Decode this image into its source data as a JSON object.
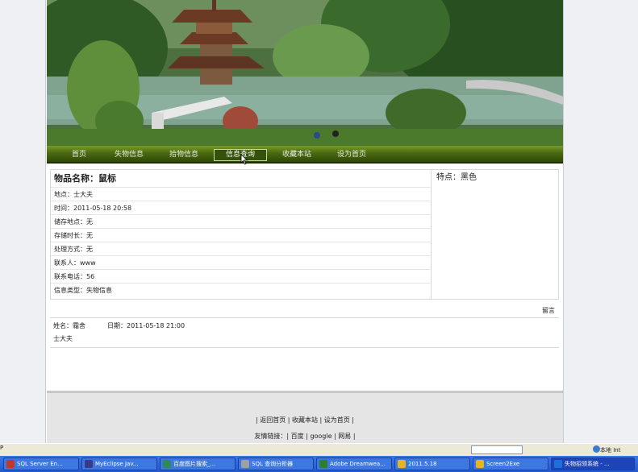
{
  "nav": {
    "items": [
      "首页",
      "失物信息",
      "拾物信息",
      "信息查询",
      "收藏本站",
      "设为首页"
    ],
    "active_index": 3
  },
  "item": {
    "name_label": "物品名称：",
    "name_value": "鼠标",
    "location": "地点：士大夫",
    "time": "时间：2011-05-18 20:58",
    "storage_location": "储存地点：无",
    "storage_duration": "存储时长：无",
    "handling_method": "处理方式：无",
    "contact_person": "联系人：www",
    "contact_phone": "联系电话：56",
    "info_type": "信息类型：失物信息",
    "features": "特点：黑色"
  },
  "message": {
    "button_label": "留言",
    "name": "姓名：霜舍",
    "date": "日期：2011-05-18 21:00",
    "content": "士大夫"
  },
  "footer": {
    "nav_line": "| 返回首页 | 收藏本站 | 设为首页 |",
    "links_label": "友情链接：",
    "links_line": "| 百度 | google | 网易 |"
  },
  "statusbar": {
    "left_text": "P",
    "right_text": "本地 Int"
  },
  "taskbar": {
    "tasks": [
      {
        "label": "SQL Server En...",
        "icon_color": "#c0392b"
      },
      {
        "label": "MyEclipse Jav...",
        "icon_color": "#3a3a8a"
      },
      {
        "label": "百度图片搜索_...",
        "icon_color": "#2e8b57"
      },
      {
        "label": "SQL 查询分析器",
        "icon_color": "#a0a0a0"
      },
      {
        "label": "Adobe Dreamwea...",
        "icon_color": "#2e7d32"
      },
      {
        "label": "2011.5.18",
        "icon_color": "#e6b422"
      },
      {
        "label": "Screen2Exe",
        "icon_color": "#e6b422"
      },
      {
        "label": "失物招领系统 - ...",
        "icon_color": "#1e6fd9"
      }
    ]
  },
  "colors": {
    "nav_dark": "#2e4806",
    "nav_light": "#7a9a2a",
    "taskbar": "#2458cf",
    "footer_bg": "#e5e5e5"
  }
}
